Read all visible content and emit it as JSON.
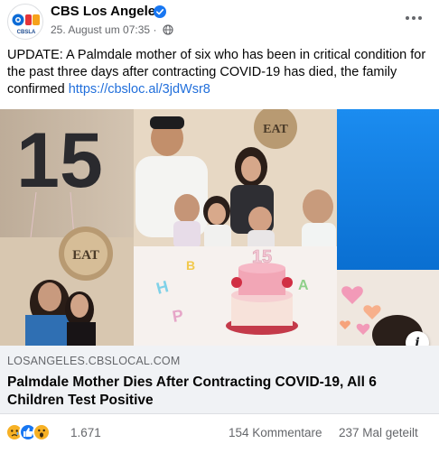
{
  "post": {
    "page_name": "CBS Los Angeles",
    "timestamp": "25. August um 07:35",
    "separator": "·",
    "avatar_label": "CBSLA",
    "text": "UPDATE: A Palmdale mother of six who has been in critical condition for the past three days after contracting COVID-19 has died, the family confirmed ",
    "link": "https://cbsloc.al/3jdWsr8",
    "icons": {
      "verified": "verified-badge-icon",
      "privacy": "globe-icon",
      "more": "more-options-icon",
      "info": "info-icon"
    }
  },
  "image": {
    "numeral": "15",
    "sign_left": "EAT",
    "sign_right": "EAT",
    "cake_number": "15"
  },
  "link_preview": {
    "domain": "LOSANGELES.CBSLOCAL.COM",
    "title": "Palmdale Mother Dies After Contracting COVID-19, All 6 Children Test Positive"
  },
  "footer": {
    "reaction_icons": [
      "sad-reaction-icon",
      "like-reaction-icon",
      "wow-reaction-icon"
    ],
    "reaction_count": "1.671",
    "comments": "154 Kommentare",
    "shares": "237 Mal geteilt"
  },
  "colors": {
    "link": "#216fdb",
    "verified": "#1877f2",
    "secondary_text": "#65676b",
    "preview_bg": "#f0f2f5"
  }
}
